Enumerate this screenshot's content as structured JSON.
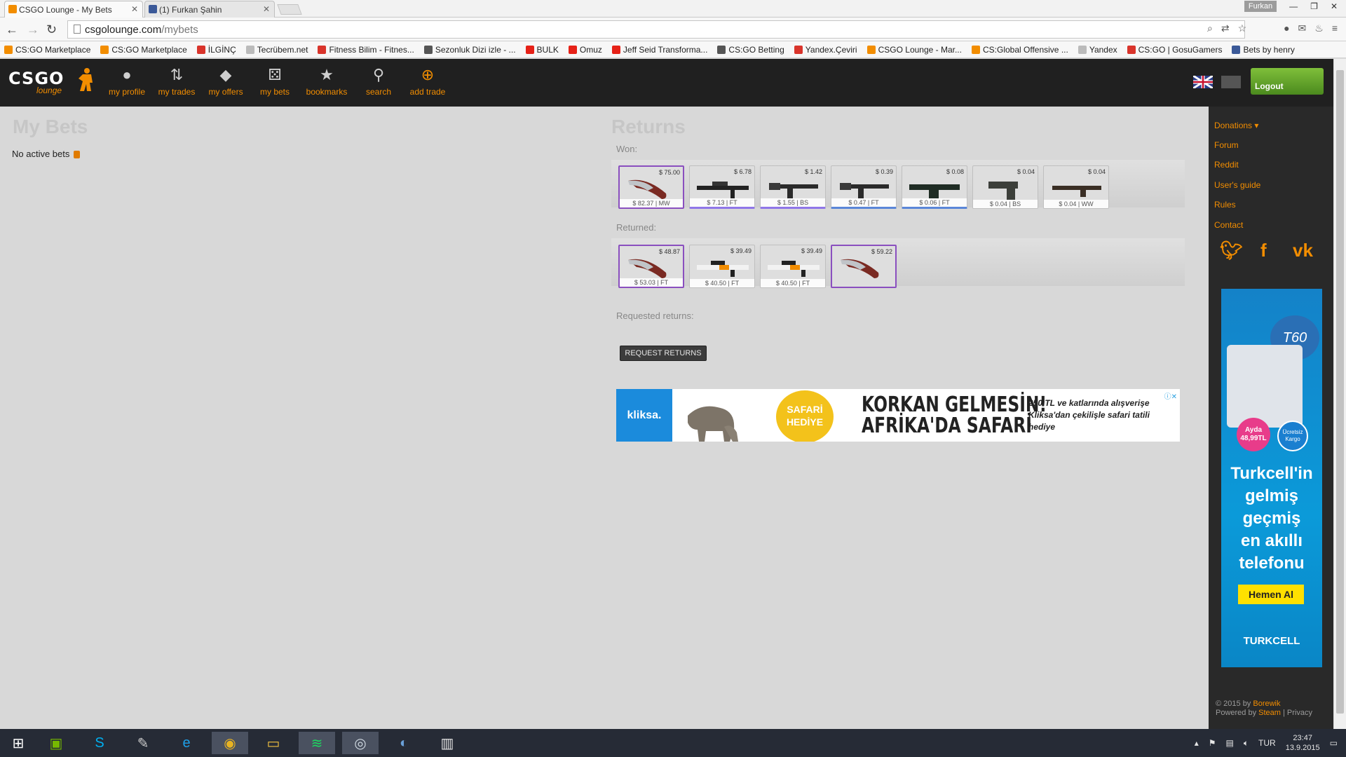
{
  "browser": {
    "tabs": [
      {
        "title": "CSGO Lounge - My Bets",
        "active": true,
        "color": "#f28d00"
      },
      {
        "title": "(1) Furkan Şahin",
        "active": false,
        "color": "#3b5998"
      }
    ],
    "user_chip": "Furkan",
    "url_host": "csgolounge.com",
    "url_path": "/mybets",
    "bookmarks": [
      {
        "label": "CS:GO Marketplace",
        "color": "#f28d00"
      },
      {
        "label": "CS:GO Marketplace",
        "color": "#f28d00"
      },
      {
        "label": "İLGİNÇ",
        "color": "#d9342b"
      },
      {
        "label": "Tecrübem.net",
        "color": "#bbbbbb"
      },
      {
        "label": "Fitness Bilim - Fitnes...",
        "color": "#d9342b"
      },
      {
        "label": "Sezonluk Dizi izle - ...",
        "color": "#555555"
      },
      {
        "label": "BULK",
        "color": "#e62117"
      },
      {
        "label": "Omuz",
        "color": "#e62117"
      },
      {
        "label": "Jeff Seid Transforma...",
        "color": "#e62117"
      },
      {
        "label": "CS:GO Betting",
        "color": "#555555"
      },
      {
        "label": "Yandex.Çeviri",
        "color": "#d9342b"
      },
      {
        "label": "CSGO Lounge - Mar...",
        "color": "#f28d00"
      },
      {
        "label": "CS:Global Offensive ...",
        "color": "#f28d00"
      },
      {
        "label": "Yandex",
        "color": "#bbbbbb"
      },
      {
        "label": "CS:GO | GosuGamers",
        "color": "#d9342b"
      },
      {
        "label": "Bets by henry",
        "color": "#3b5998"
      }
    ]
  },
  "site": {
    "logo": "CSGO",
    "logo_sub": "lounge",
    "accent": "#f28d00",
    "nav": [
      {
        "label": "my profile",
        "icon": "user-icon"
      },
      {
        "label": "my trades",
        "icon": "trades-icon"
      },
      {
        "label": "my offers",
        "icon": "tag-icon"
      },
      {
        "label": "my bets",
        "icon": "dice-icon"
      },
      {
        "label": "bookmarks",
        "icon": "star-icon"
      },
      {
        "label": "search",
        "icon": "search-icon"
      },
      {
        "label": "add trade",
        "icon": "plus-icon"
      }
    ],
    "logout_label": "Logout"
  },
  "main": {
    "mybets_title": "My Bets",
    "no_active": "No active bets",
    "returns_title": "Returns",
    "won_label": "Won:",
    "returned_label": "Returned:",
    "requested_label": "Requested returns:",
    "request_button": "REQUEST RETURNS",
    "won_items": [
      {
        "price": "$ 75.00",
        "value": "$ 82.37 | MW",
        "weapon": "knife",
        "grade": "covert"
      },
      {
        "price": "$ 6.78",
        "value": "$ 7.13 | FT",
        "weapon": "sniper",
        "grade": "ms"
      },
      {
        "price": "$ 1.42",
        "value": "$ 1.55 | BS",
        "weapon": "rifle",
        "grade": "ms"
      },
      {
        "price": "$ 0.39",
        "value": "$ 0.47 | FT",
        "weapon": "rifle",
        "grade": "cl"
      },
      {
        "price": "$ 0.08",
        "value": "$ 0.06 | FT",
        "weapon": "lmg",
        "grade": "cl"
      },
      {
        "price": "$ 0.04",
        "value": "$ 0.04 | BS",
        "weapon": "pistol",
        "grade": "none"
      },
      {
        "price": "$ 0.04",
        "value": "$ 0.04 | WW",
        "weapon": "shotgun",
        "grade": "none"
      }
    ],
    "returned_items": [
      {
        "price": "$ 48.87",
        "value": "$ 53.03 | FT",
        "weapon": "knife",
        "grade": "covert"
      },
      {
        "price": "$ 39.49",
        "value": "$ 40.50 | FT",
        "weapon": "asiimov",
        "grade": "none"
      },
      {
        "price": "$ 39.49",
        "value": "$ 40.50 | FT",
        "weapon": "asiimov",
        "grade": "none"
      },
      {
        "price": "$ 59.22",
        "value": "",
        "weapon": "knife",
        "grade": "covert"
      }
    ]
  },
  "banner_ad": {
    "brand": "kliksa.",
    "badge": "SAFARİ HEDİYE",
    "headline1": "KORKAN GELMESİN!",
    "headline2": "AFRİKA'DA SAFARİ",
    "subtext": "250 TL ve katlarında alışverişe Kliksa'dan çekilişle safari tatili hediye"
  },
  "sidebar": {
    "links": [
      "Donations ▾",
      "Forum",
      "Reddit",
      "User's guide",
      "Rules",
      "Contact"
    ],
    "social": [
      "twitter-icon",
      "facebook-icon",
      "vk-icon"
    ],
    "ad": {
      "model": "T60",
      "price_line1": "Ayda",
      "price_line2": "48,99TL",
      "cargo": "Ücretsiz Kargo",
      "text_lines": [
        "Turkcell'in",
        "gelmiş",
        "geçmiş",
        "en akıllı",
        "telefonu"
      ],
      "button": "Hemen Al",
      "brand": "TURKCELL"
    },
    "footer_prefix": "© 2015 by",
    "footer_author": "Borewik",
    "footer_powered": "Powered by",
    "footer_steam": "Steam",
    "footer_privacy": "| Privacy"
  },
  "taskbar": {
    "apps": [
      "windows-start-icon",
      "nvidia-icon",
      "skype-icon",
      "paint-icon",
      "ie-icon",
      "chrome-icon",
      "explorer-icon",
      "spotify-icon",
      "steam-icon",
      "teamspeak-icon",
      "app-icon"
    ],
    "lang": "TUR",
    "time": "23:47",
    "date": "13.9.2015"
  }
}
